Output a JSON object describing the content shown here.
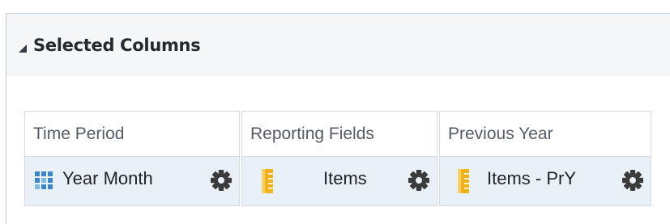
{
  "panel": {
    "title": "Selected Columns"
  },
  "columns": [
    {
      "header": "Time Period",
      "item": "Year Month",
      "item_icon": "grid-icon",
      "settings_icon": "gear-icon"
    },
    {
      "header": "Reporting Fields",
      "item": "Items",
      "item_icon": "ruler-icon",
      "settings_icon": "gear-icon"
    },
    {
      "header": "Previous Year",
      "item": "Items - PrY",
      "item_icon": "ruler-icon",
      "settings_icon": "gear-icon"
    }
  ],
  "colors": {
    "header_bg": "#f4f6f8",
    "row_bg": "#eaf0f8",
    "grid_icon": "#3a86c8",
    "ruler_icon": "#f2b21c",
    "gear_icon": "#3b3b3b"
  }
}
